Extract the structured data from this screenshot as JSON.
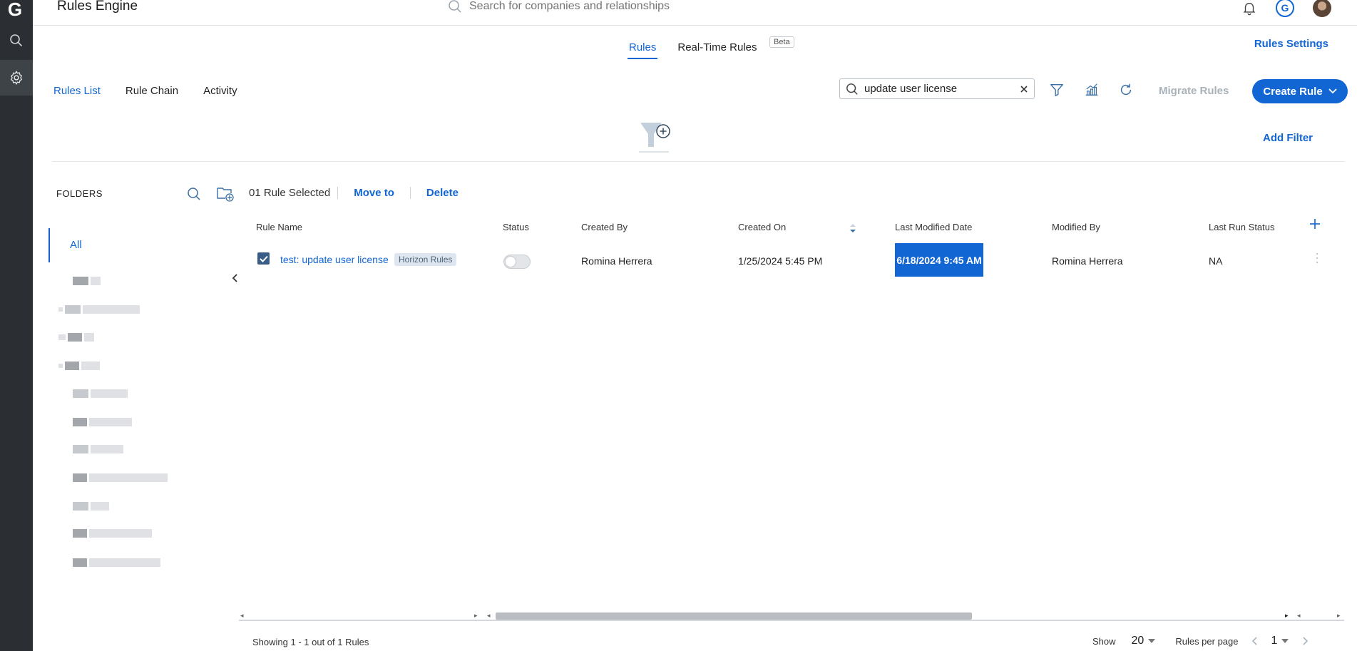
{
  "app": {
    "title": "Rules Engine",
    "logo_letter": "G"
  },
  "header": {
    "search_placeholder": "Search for companies and relationships",
    "profile_letter": "G"
  },
  "main_tabs": [
    {
      "label": "Rules",
      "active": true
    },
    {
      "label": "Real-Time Rules",
      "active": false
    }
  ],
  "beta_badge": "Beta",
  "rules_settings_label": "Rules Settings",
  "sub_nav": [
    {
      "label": "Rules List",
      "active": true
    },
    {
      "label": "Rule Chain",
      "active": false
    },
    {
      "label": "Activity",
      "active": false
    }
  ],
  "toolbar": {
    "search_value": "update user license",
    "migrate_label": "Migrate Rules",
    "create_label": "Create Rule",
    "add_filter_label": "Add Filter"
  },
  "folders": {
    "title": "FOLDERS",
    "all_label": "All"
  },
  "selection": {
    "count_label": "01 Rule Selected",
    "move_label": "Move to",
    "delete_label": "Delete"
  },
  "table": {
    "columns": [
      "Rule Name",
      "Status",
      "Created By",
      "Created On",
      "Last Modified Date",
      "Modified By",
      "Last Run Status"
    ],
    "rows": [
      {
        "rule_name": "test: update user license",
        "tag": "Horizon Rules",
        "status_enabled": false,
        "created_by": "Romina Herrera",
        "created_on": "1/25/2024 5:45 PM",
        "last_modified": "6/18/2024 9:45 AM",
        "modified_by": "Romina Herrera",
        "last_run_status": "NA"
      }
    ]
  },
  "footer": {
    "showing": "Showing 1 - 1 out of 1 Rules",
    "show_label": "Show",
    "page_size": "20",
    "per_page_label": "Rules per page",
    "page": "1"
  },
  "colors": {
    "accent": "#1266d4",
    "rail": "#2b2f33"
  },
  "icons": [
    "search-icon",
    "settings-icon",
    "bell-icon",
    "filter-icon",
    "analytics-icon",
    "refresh-icon",
    "funnel-add-icon",
    "new-folder-icon",
    "clear-icon",
    "chevron-down-icon",
    "chevron-left-icon",
    "plus-icon",
    "kebab-icon"
  ]
}
